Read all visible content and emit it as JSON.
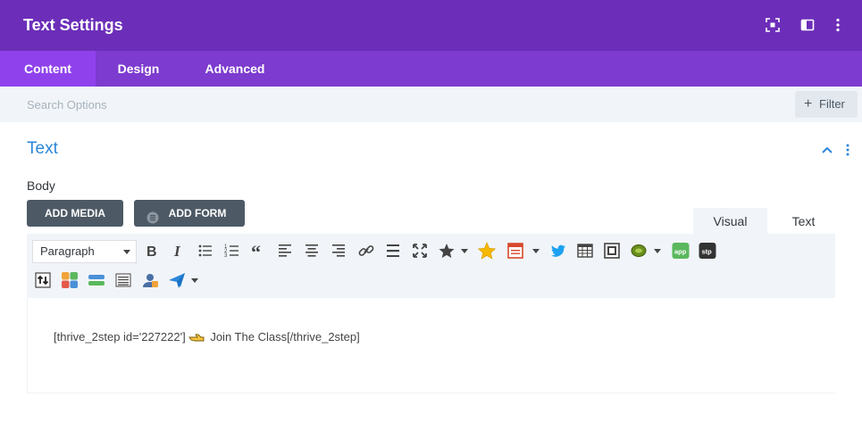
{
  "header": {
    "title": "Text Settings"
  },
  "tabs": [
    {
      "label": "Content",
      "active": true
    },
    {
      "label": "Design",
      "active": false
    },
    {
      "label": "Advanced",
      "active": false
    }
  ],
  "search": {
    "placeholder": "Search Options",
    "filter_label": "Filter"
  },
  "section": {
    "title": "Text"
  },
  "body_label": "Body",
  "buttons": {
    "add_media": "ADD MEDIA",
    "add_form": "ADD FORM"
  },
  "editor_modes": {
    "visual": "Visual",
    "text": "Text"
  },
  "toolbar": {
    "format_select": "Paragraph"
  },
  "content": {
    "before": "[thrive_2step id='227222']",
    "after": " Join The Class[/thrive_2step]"
  },
  "colors": {
    "header_bg": "#6c2eb9",
    "tabs_bg": "#7d3bcf",
    "tab_active_bg": "#8f42ec",
    "section_title": "#2b87da",
    "dark_button": "#4d5965"
  }
}
